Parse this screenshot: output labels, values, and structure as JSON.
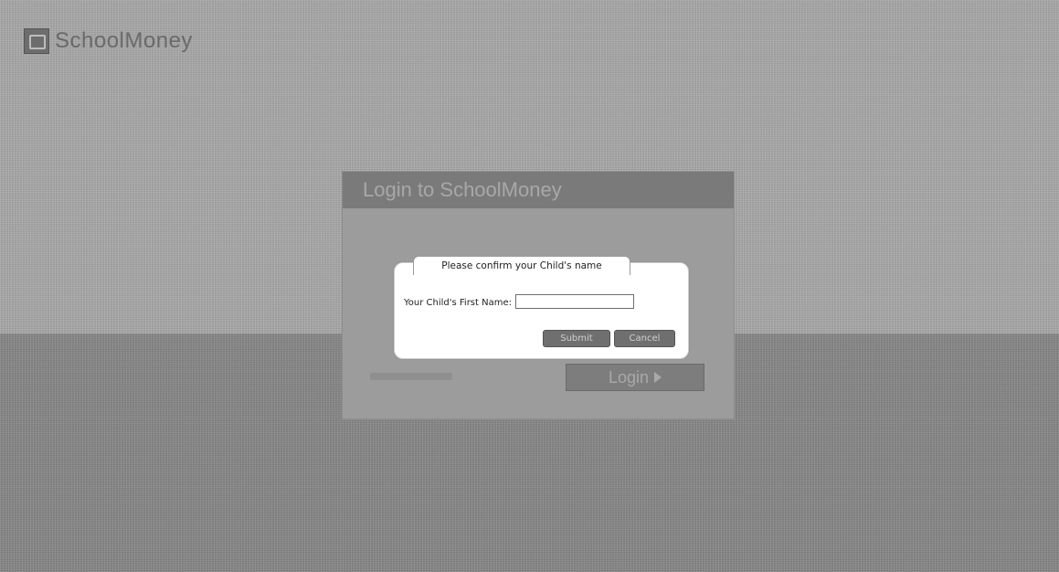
{
  "app": {
    "logo_text": "SchoolMoney"
  },
  "login_panel": {
    "title": "Login to SchoolMoney",
    "login_button": "Login"
  },
  "dialog": {
    "title": "Please confirm your Child's name",
    "field_label": "Your Child's First Name:",
    "input_value": "",
    "submit_label": "Submit",
    "cancel_label": "Cancel"
  }
}
